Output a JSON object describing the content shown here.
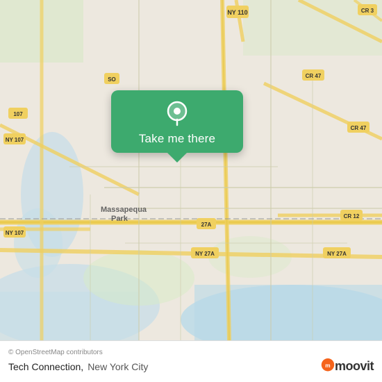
{
  "map": {
    "alt": "Map of Massapequa Park, New York City area",
    "background_color": "#e8e8dc"
  },
  "popup": {
    "label": "Take me there",
    "pin_color": "#ffffff"
  },
  "footer": {
    "copyright": "© OpenStreetMap contributors",
    "place_name": "Tech Connection,",
    "place_city": "New York City",
    "moovit_text": "moovit"
  }
}
